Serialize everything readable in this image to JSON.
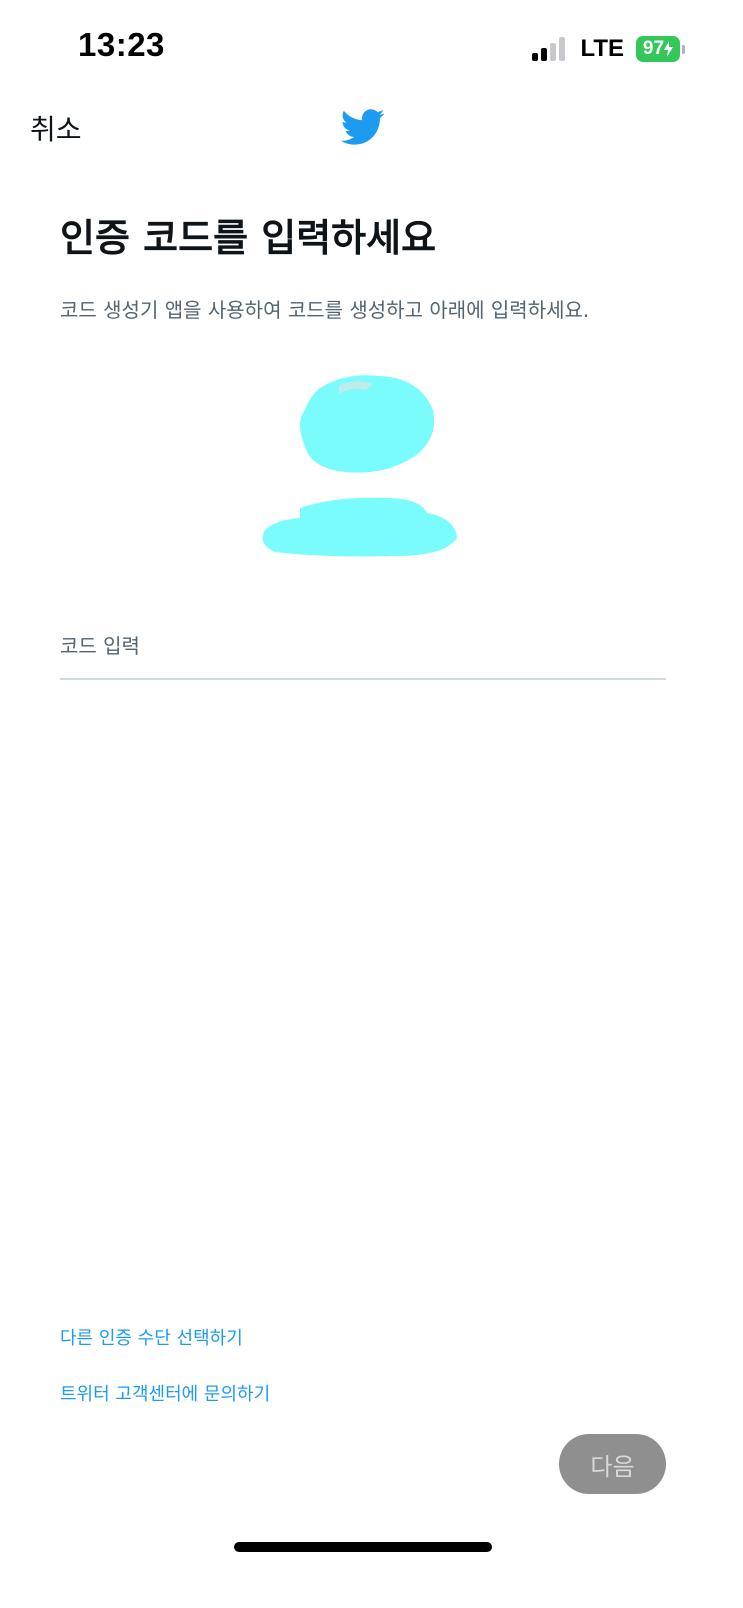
{
  "status_bar": {
    "time": "13:23",
    "network": "LTE",
    "battery": "97"
  },
  "nav": {
    "cancel_label": "취소",
    "logo_icon": "twitter-bird-icon",
    "brand_color": "#1d9bf0"
  },
  "main": {
    "title": "인증 코드를 입력하세요",
    "subtitle": "코드 생성기 앱을 사용하여 코드를 생성하고 아래에 입력하세요.",
    "code_input": {
      "placeholder": "코드 입력",
      "value": ""
    }
  },
  "links": {
    "other_method": "다른 인증 수단 선택하기",
    "contact_support": "트위터 고객센터에 문의하기"
  },
  "footer": {
    "next_label": "다음",
    "next_enabled": false
  }
}
